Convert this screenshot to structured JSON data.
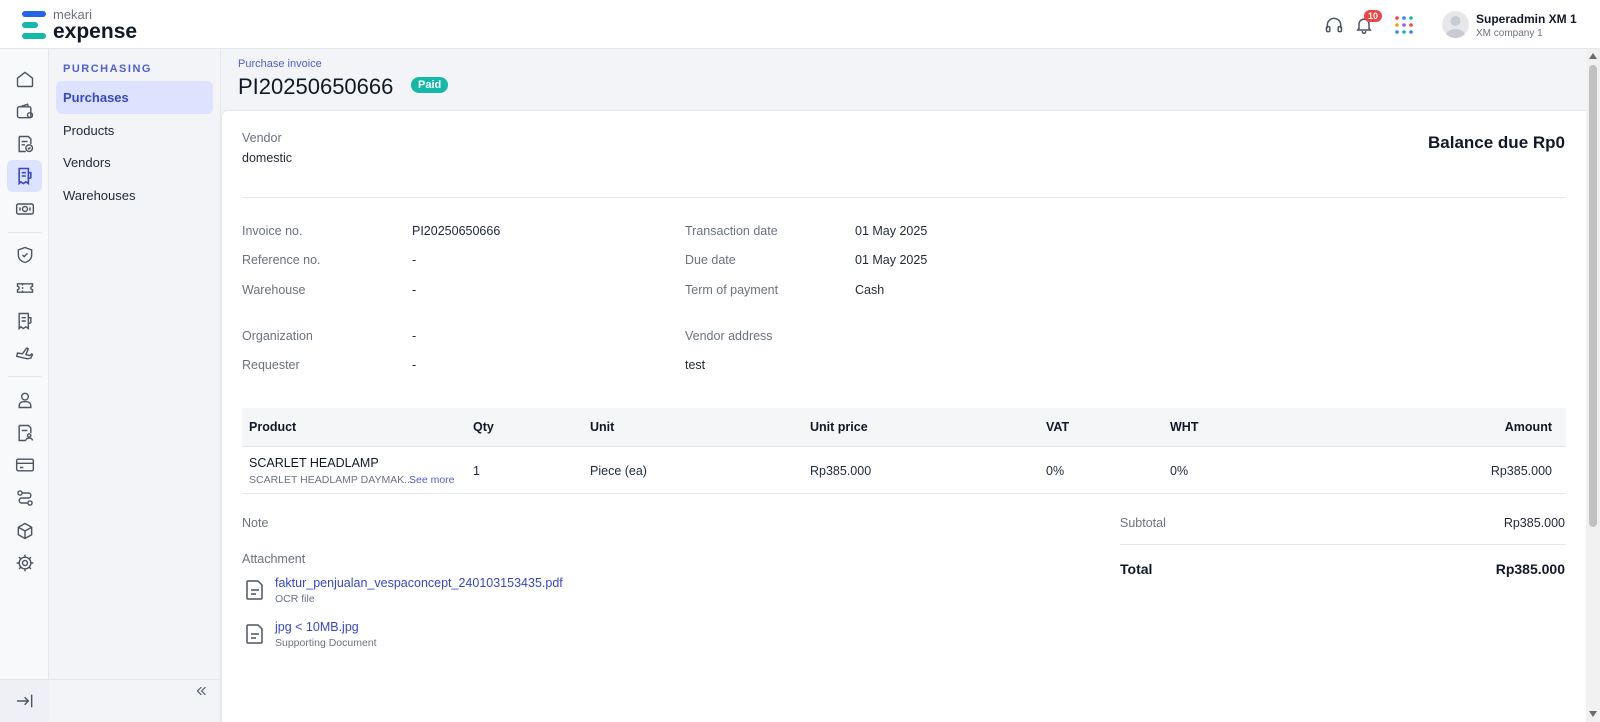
{
  "brand": {
    "line1": "mekari",
    "line2": "expense"
  },
  "header": {
    "notification_count": "10",
    "user_name": "Superadmin XM 1",
    "user_company": "XM company 1"
  },
  "rail": {
    "icons": [
      "home-icon",
      "wallet-icon",
      "receipt-check-icon",
      "purchase-icon",
      "money-icon",
      "shield-check-icon",
      "ticket-icon",
      "invoice-icon",
      "plane-icon",
      "person-icon",
      "document-user-icon",
      "card-icon",
      "flow-icon",
      "box-icon",
      "gear-icon"
    ],
    "active_index": 3
  },
  "subnav": {
    "heading": "PURCHASING",
    "items": [
      {
        "label": "Purchases",
        "active": true
      },
      {
        "label": "Products"
      },
      {
        "label": "Vendors"
      },
      {
        "label": "Warehouses"
      }
    ]
  },
  "page": {
    "breadcrumb": "Purchase invoice",
    "title": "PI20250650666",
    "status": "Paid"
  },
  "invoice": {
    "vendor_label": "Vendor",
    "vendor_value": "domestic",
    "balance_due": "Balance due Rp0",
    "fields_left": [
      {
        "label": "Invoice no.",
        "value": "PI20250650666"
      },
      {
        "label": "Reference no.",
        "value": "-"
      },
      {
        "label": "Warehouse",
        "value": "-"
      }
    ],
    "fields_right": [
      {
        "label": "Transaction date",
        "value": "01 May 2025"
      },
      {
        "label": "Due date",
        "value": "01 May 2025"
      },
      {
        "label": "Term of payment",
        "value": "Cash"
      }
    ],
    "organization_label": "Organization",
    "organization_value": "-",
    "requester_label": "Requester",
    "requester_value": "-",
    "vendor_address_label": "Vendor address",
    "vendor_address_value": "test"
  },
  "table": {
    "headers": [
      "Product",
      "Qty",
      "Unit",
      "Unit price",
      "VAT",
      "WHT",
      "Amount"
    ],
    "rows": [
      {
        "product": "SCARLET HEADLAMP",
        "description": "SCARLET HEADLAMP DAYMAK...",
        "see_more": "See more",
        "qty": "1",
        "unit": "Piece (ea)",
        "unit_price": "Rp385.000",
        "vat": "0%",
        "wht": "0%",
        "amount": "Rp385.000"
      }
    ]
  },
  "note_label": "Note",
  "attachment_label": "Attachment",
  "attachments": [
    {
      "name": "faktur_penjualan_vespaconcept_240103153435.pdf",
      "type": "OCR file"
    },
    {
      "name": "jpg < 10MB.jpg",
      "type": "Supporting Document"
    }
  ],
  "totals": {
    "subtotal_label": "Subtotal",
    "subtotal_value": "Rp385.000",
    "total_label": "Total",
    "total_value": "Rp385.000"
  },
  "colors": {
    "accent": "#4f5fd6",
    "paid_badge": "#14b8a6",
    "notification": "#ef4444"
  }
}
